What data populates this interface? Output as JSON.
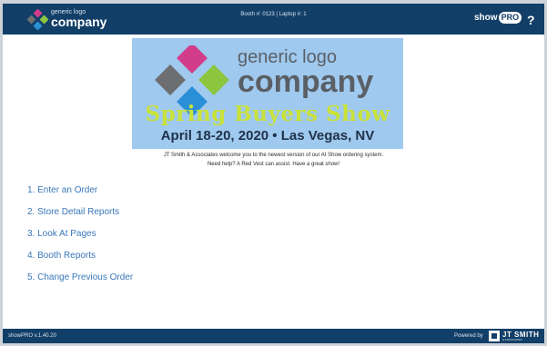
{
  "header": {
    "logo": {
      "line1": "generic logo",
      "line2": "company"
    },
    "booth_info": "Booth #: 0123 | Laptop #: 1",
    "app_logo": {
      "show": "show",
      "pro": "PRO"
    },
    "help_label": "?"
  },
  "banner": {
    "logo": {
      "line1": "generic logo",
      "line2": "company"
    },
    "show_name": "Spring Buyers Show",
    "show_dates": "April 18-20, 2020 • Las Vegas, NV"
  },
  "welcome": {
    "line1": "JT Smith & Associates welcome you to the newest version of our At Show ordering system.",
    "line2": "Need help? A Red Vest can assist. Have a great show!"
  },
  "menu": {
    "items": [
      {
        "label": "1. Enter an Order"
      },
      {
        "label": "2. Store Detail Reports"
      },
      {
        "label": "3. Look At Pages"
      },
      {
        "label": "4. Booth Reports"
      },
      {
        "label": "5. Change Previous Order"
      }
    ]
  },
  "footer": {
    "version": "showPRO v.1.40.20",
    "powered_by": "Powered by",
    "company_logo": {
      "name": "JT SMITH",
      "sub": "& ASSOCIATES"
    }
  },
  "colors": {
    "header_bar": "#123f68",
    "banner_bg": "#9fc9ee",
    "show_name": "#c9e23a",
    "menu_link": "#3a77b8",
    "logo_magenta": "#d23d8b",
    "logo_green": "#8cc63f",
    "logo_blue": "#2a8fd6",
    "logo_gray": "#6d6e71"
  }
}
